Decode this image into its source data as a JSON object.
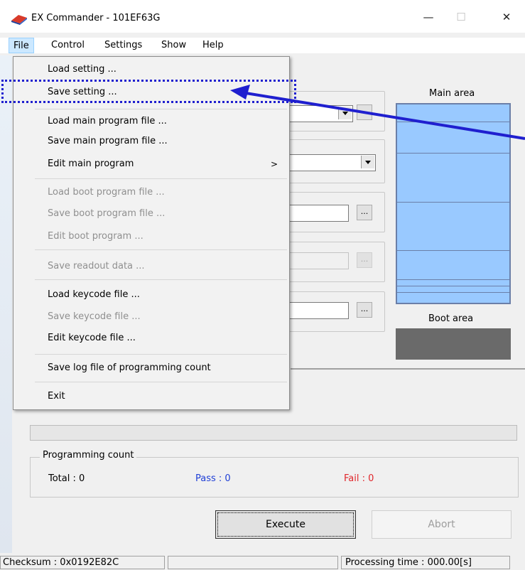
{
  "window": {
    "title": "EX Commander - 101EF63G",
    "buttons": {
      "minimize": "—",
      "maximize": "☐",
      "close": "✕"
    }
  },
  "menubar": {
    "items": [
      "File",
      "Control",
      "Settings",
      "Show",
      "Help"
    ]
  },
  "file_menu": {
    "items": [
      {
        "label": "Load setting ...",
        "enabled": true
      },
      {
        "label": "Save setting ...",
        "enabled": true
      },
      {
        "label": "Load main program file ...",
        "enabled": true
      },
      {
        "label": "Save main program file ...",
        "enabled": true
      },
      {
        "label": "Edit main program",
        "enabled": true,
        "submenu": ">"
      },
      {
        "label": "Load boot program file ...",
        "enabled": false
      },
      {
        "label": "Save boot program file ...",
        "enabled": false
      },
      {
        "label": "Edit boot program ...",
        "enabled": false
      },
      {
        "label": "Save readout data ...",
        "enabled": false
      },
      {
        "label": "Load keycode file ...",
        "enabled": true
      },
      {
        "label": "Save keycode file ...",
        "enabled": false
      },
      {
        "label": "Edit keycode file ...",
        "enabled": true
      },
      {
        "label": "Save log file of programming count",
        "enabled": true
      },
      {
        "label": "Exit",
        "enabled": true
      }
    ]
  },
  "memory_map": {
    "main_label": "Main area",
    "boot_label": "Boot area"
  },
  "browse_label": "...",
  "programming_count": {
    "legend": "Programming count",
    "total": "Total : 0",
    "pass": "Pass : 0",
    "fail": "Fail : 0"
  },
  "buttons": {
    "execute": "Execute",
    "abort": "Abort"
  },
  "statusbar": {
    "checksum": "Checksum : 0x0192E82C",
    "processing_time": "Processing time : 000.00[s]"
  },
  "colors": {
    "pass": "#1f3fd6",
    "fail": "#e0262b",
    "annotation": "#1f1fcf",
    "main_area": "#99c9ff",
    "boot_area": "#6a6a6a"
  }
}
